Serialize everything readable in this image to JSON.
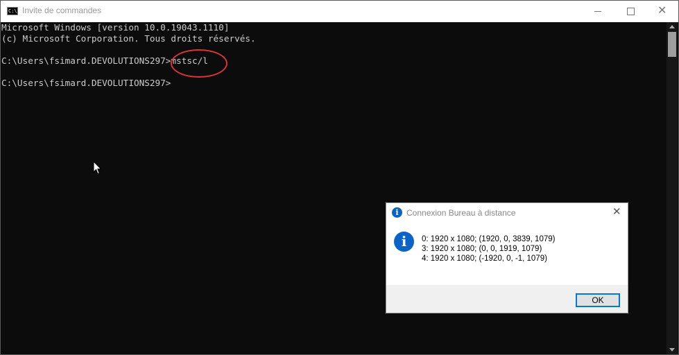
{
  "window": {
    "title": "Invite de commandes",
    "app_icon_text": "C:\\",
    "minimize_glyph": "",
    "close_glyph": "✕"
  },
  "console": {
    "lines": [
      "Microsoft Windows [version 10.0.19043.1110]",
      "(c) Microsoft Corporation. Tous droits réservés.",
      "",
      "C:\\Users\\fsimard.DEVOLUTIONS297>mstsc/l",
      "",
      "C:\\Users\\fsimard.DEVOLUTIONS297>"
    ]
  },
  "dialog": {
    "title": "Connexion Bureau à distance",
    "title_icon": "i",
    "info_icon": "i",
    "close_glyph": "✕",
    "lines": [
      "0: 1920 x 1080; (1920, 0, 3839, 1079)",
      "3: 1920 x 1080; (0, 0, 1919, 1079)",
      "4: 1920 x 1080; (-1920, 0, -1, 1079)"
    ],
    "ok_label": "OK"
  },
  "colors": {
    "console_bg": "#0c0c0c",
    "console_fg": "#cccccc",
    "highlight_ring": "#dd3333",
    "info_blue": "#0a63c9",
    "button_focus": "#0078d7"
  },
  "icons": [
    "console-app-icon",
    "minimize-icon",
    "maximize-icon",
    "close-icon",
    "mouse-pointer-icon",
    "info-icon"
  ]
}
